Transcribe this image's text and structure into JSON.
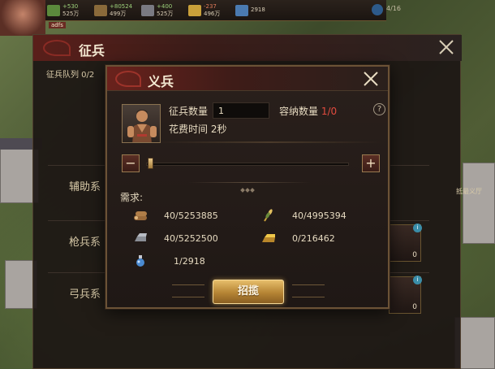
{
  "topbar": {
    "resources": [
      {
        "icon": "food-icon",
        "color": "#5b8a3c",
        "delta": "+530",
        "amount": "525万"
      },
      {
        "icon": "wood-icon",
        "color": "#8a6a3a",
        "delta": "+80524",
        "amount": "499万"
      },
      {
        "icon": "stone-icon",
        "color": "#7a7a82",
        "delta": "+400",
        "amount": "525万"
      },
      {
        "icon": "gold-icon",
        "color": "#c9a03a",
        "delta": "-237",
        "amount": "496万"
      },
      {
        "icon": "gem-icon",
        "color": "#4a7ab0",
        "delta": "",
        "amount": "2918"
      }
    ],
    "level": "4/16",
    "player_name": "adfs"
  },
  "outer_panel": {
    "title": "征兵",
    "queue_label": "征兵队列 0/2",
    "categories": [
      {
        "label": "辅助系"
      },
      {
        "label": "枪兵系",
        "count": "0"
      },
      {
        "label": "弓兵系",
        "count": "0"
      }
    ],
    "side_note": "抵最义厅"
  },
  "dialog": {
    "title": "义兵",
    "qty_label": "征兵数量",
    "qty_value": "1",
    "capacity_label": "容纳数量",
    "capacity_value": "1/0",
    "time_label": "花费时间",
    "time_value": "2秒",
    "help_glyph": "?",
    "minus_glyph": "−",
    "plus_glyph": "+",
    "slider_fraction": 0.0,
    "requirements_title": "需求:",
    "requirements": [
      {
        "icon": "wood-icon",
        "value": "40/5253885"
      },
      {
        "icon": "food-icon",
        "value": "40/4995394"
      },
      {
        "icon": "iron-icon",
        "value": "40/5252500"
      },
      {
        "icon": "gold-icon",
        "value": "0/216462"
      },
      {
        "icon": "potion-icon",
        "value": "1/2918"
      }
    ],
    "recruit_label": "招揽"
  }
}
